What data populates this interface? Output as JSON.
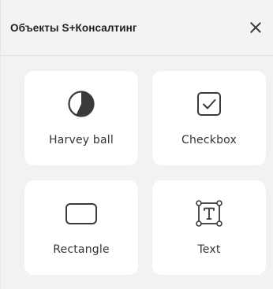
{
  "panel": {
    "title": "Объекты S+Консалтинг",
    "close_icon": "close-icon"
  },
  "items": [
    {
      "label": "Harvey ball",
      "icon": "harvey-ball-icon"
    },
    {
      "label": "Checkbox",
      "icon": "checkbox-icon"
    },
    {
      "label": "Rectangle",
      "icon": "rectangle-icon"
    },
    {
      "label": "Text",
      "icon": "text-box-icon"
    }
  ],
  "colors": {
    "panel_background": "#f2f2f2",
    "card_background": "#ffffff",
    "icon_stroke": "#3a3a3a"
  }
}
